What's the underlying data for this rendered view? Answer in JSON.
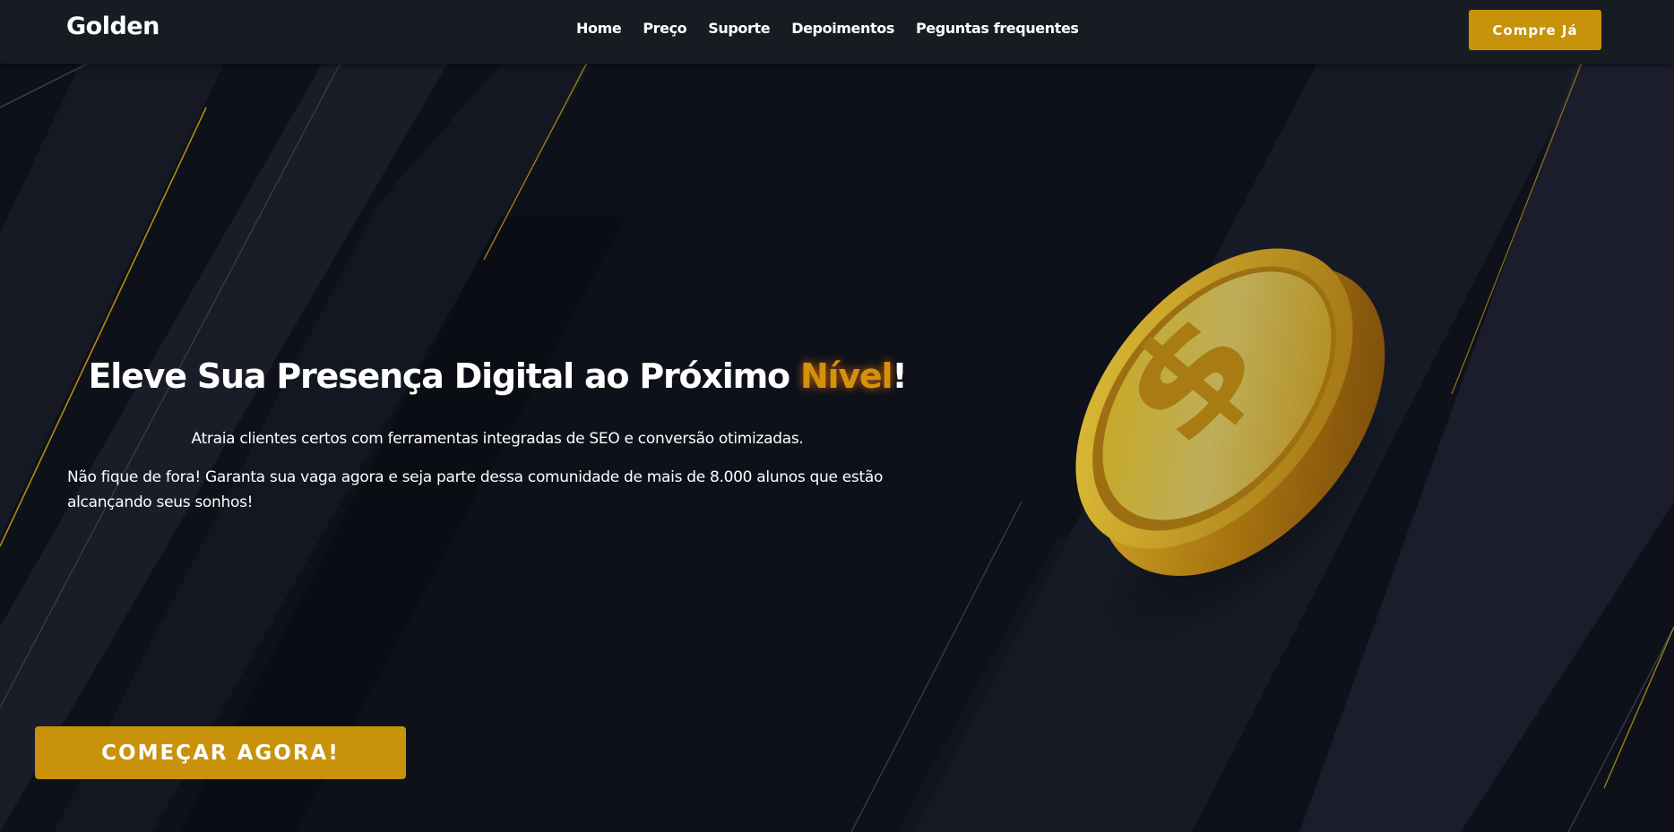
{
  "header": {
    "logo": "Golden",
    "nav": [
      "Home",
      "Preço",
      "Suporte",
      "Depoimentos",
      "Peguntas frequentes"
    ],
    "buy_button": "Compre Já"
  },
  "hero": {
    "title_main": "Eleve Sua Presença Digital ao Próximo ",
    "title_accent": "Nível",
    "title_end": "!",
    "subtitle": "Atraia clientes certos com ferramentas integradas de SEO e conversão otimizadas.",
    "body": "Não fique de fora! Garanta sua vaga agora e seja parte dessa comunidade de mais de 8.000 alunos que estão alcançando seus sonhos!",
    "cta_button": "COMEÇAR AGORA!",
    "image_icon": "gold-dollar-coin-icon"
  },
  "colors": {
    "background": "#0e1119",
    "header": "#171c22",
    "accent": "#c8920a",
    "accent_text": "#d4920c"
  }
}
